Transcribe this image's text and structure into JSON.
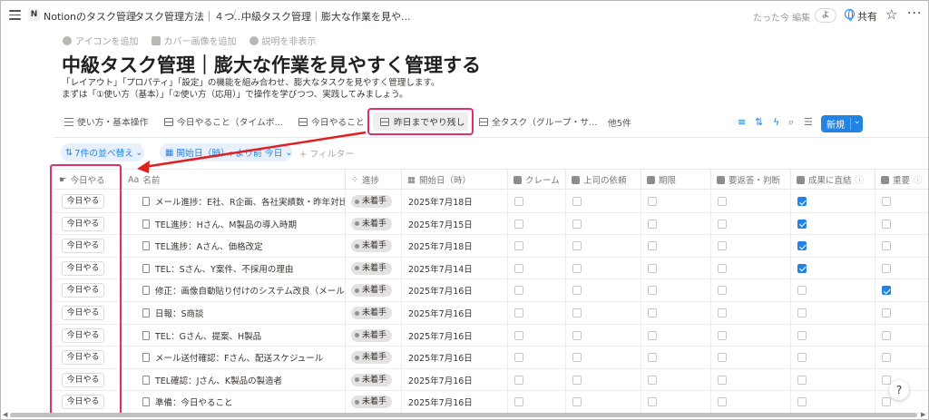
{
  "breadcrumb": {
    "badge": "N",
    "items": [
      "Notionのタスク管理",
      "タスク管理方法｜４つ...",
      "中級タスク管理｜膨大な作業を見や..."
    ]
  },
  "topbar": {
    "edited": "たった今 編集",
    "user": "よ",
    "share": "共有",
    "star": "☆",
    "more": "···"
  },
  "page_actions": [
    "アイコンを追加",
    "カバー画像を追加",
    "説明を非表示"
  ],
  "title": "中級タスク管理｜膨大な作業を見やすく管理する",
  "description": [
    "「レイアウト」「プロパティ」「設定」の機能を組み合わせ、膨大なタスクを見やすく管理します。",
    "まずは「①使い方（基本）」「②使い方（応用）」で操作を学びつつ、実践してみましょう。"
  ],
  "tabs": [
    "使い方・基本操作",
    "今日やること（タイムボ...",
    "今日やること",
    "昨日までやり残し",
    "全タスク（グループ・サ..."
  ],
  "tabs_more": "他5件",
  "new_button": "新規",
  "sort_chip": "7件の並べ替え",
  "filter_chip": "開始日（時）: より前 今日",
  "add_filter": "+ フィルター",
  "columns": [
    "今日やる",
    "名前",
    "進捗",
    "開始日（時）",
    "クレーム",
    "上司の依頼",
    "期限",
    "要返答・判断",
    "成果に直結",
    "重要"
  ],
  "rows": [
    {
      "btn": "今日やる",
      "name": "メール進捗：E社、R企画、各社実績数・昨年対比",
      "status": "未着手",
      "date": "2025年7月18日",
      "cb": [
        false,
        false,
        false,
        false,
        true,
        false
      ]
    },
    {
      "btn": "今日やる",
      "name": "TEL進捗：Hさん、M製品の導入時期",
      "status": "未着手",
      "date": "2025年7月15日",
      "cb": [
        false,
        false,
        false,
        false,
        true,
        false
      ]
    },
    {
      "btn": "今日やる",
      "name": "TEL進捗：Aさん、価格改定",
      "status": "未着手",
      "date": "2025年7月18日",
      "cb": [
        false,
        false,
        false,
        false,
        true,
        false
      ]
    },
    {
      "btn": "今日やる",
      "name": "TEL：Sさん、Y案件、不採用の理由",
      "status": "未着手",
      "date": "2025年7月14日",
      "cb": [
        false,
        false,
        false,
        false,
        true,
        false
      ]
    },
    {
      "btn": "今日やる",
      "name": "修正：画像自動貼り付けのシステム改良（メール",
      "status": "未着手",
      "date": "2025年7月16日",
      "cb": [
        false,
        false,
        false,
        false,
        false,
        true
      ]
    },
    {
      "btn": "今日やる",
      "name": "日報：S商談",
      "status": "未着手",
      "date": "2025年7月16日",
      "cb": [
        false,
        false,
        false,
        false,
        false,
        false
      ]
    },
    {
      "btn": "今日やる",
      "name": "TEL：Gさん、提案、H製品",
      "status": "未着手",
      "date": "2025年7月16日",
      "cb": [
        false,
        false,
        false,
        false,
        false,
        false
      ]
    },
    {
      "btn": "今日やる",
      "name": "メール送付確認：Fさん、配送スケジュール",
      "status": "未着手",
      "date": "2025年7月16日",
      "cb": [
        false,
        false,
        false,
        false,
        false,
        false
      ]
    },
    {
      "btn": "今日やる",
      "name": "TEL確認：Jさん、K製品の製造者",
      "status": "未着手",
      "date": "2025年7月16日",
      "cb": [
        false,
        false,
        false,
        false,
        false,
        false
      ]
    },
    {
      "btn": "今日やる",
      "name": "準備：今日やること",
      "status": "未着手",
      "date": "2025年7月16日",
      "cb": [
        false,
        false,
        false,
        false,
        false,
        false
      ]
    }
  ],
  "colors": {
    "accent": "#2383e2",
    "highlight": "#e0306a",
    "arrow": "#e02020"
  },
  "help_icon": "?"
}
